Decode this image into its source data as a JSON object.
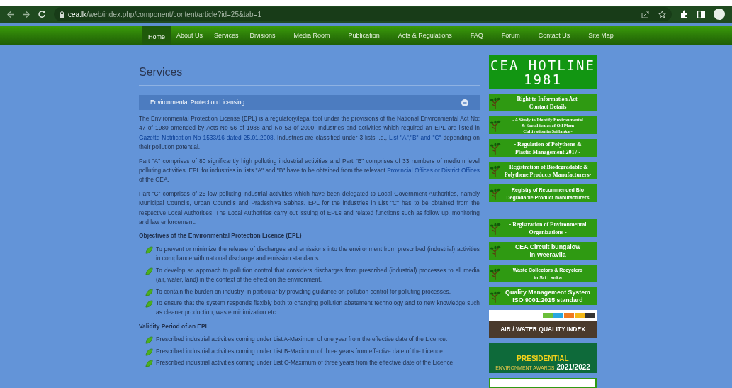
{
  "browser": {
    "url_host": "cea.lk",
    "url_path": "/web/index.php/component/content/article?id=25&tab=1"
  },
  "nav": [
    {
      "label": "Home",
      "selected": true
    },
    {
      "label": "About Us",
      "selected": false
    },
    {
      "label": "Services",
      "selected": false
    },
    {
      "label": "Divisions",
      "selected": false
    },
    {
      "label": "Media Room",
      "selected": false
    },
    {
      "label": "Publication",
      "selected": false
    },
    {
      "label": "Acts & Regulations",
      "selected": false
    },
    {
      "label": "FAQ",
      "selected": false
    },
    {
      "label": "Forum",
      "selected": false
    },
    {
      "label": "Contact Us",
      "selected": false
    },
    {
      "label": "Site Map",
      "selected": false
    }
  ],
  "page_title": "Services",
  "accordion": {
    "title": "Environmental Protection Licensing",
    "expanded": true
  },
  "paragraphs": [
    [
      {
        "kind": "text",
        "text": "The Environmental Protection License (EPL) is a regulatory/legal tool under the provisions of the National Environmental Act No: 47 of 1980 amended by Acts No 56 of 1988 and No 53 of 2000. Industries and activities which required an EPL are listed in "
      },
      {
        "kind": "link",
        "text": "Gazette Notification No 1533/16 dated 25.01.2008"
      },
      {
        "kind": "text",
        "text": ". Industries are classified under 3 lists i.e., "
      },
      {
        "kind": "link",
        "text": "List \"A\",\"B\" and \"C\""
      },
      {
        "kind": "text",
        "text": " depending on their pollution potential."
      }
    ],
    [
      {
        "kind": "text",
        "text": "Part \"A\" comprises of 80 significantly high polluting industrial activities and Part \"B\" comprises of 33 numbers of medium level polluting activities. EPL for industries in lists \"A\" and \"B\" have to be obtained from the relevant "
      },
      {
        "kind": "link",
        "text": "Provincial Offices or District Offices"
      },
      {
        "kind": "text",
        "text": " of the CEA."
      }
    ],
    [
      {
        "kind": "text",
        "text": "Part \"C\" comprises of 25 low polluting industrial activities which have been delegated to Local Government Authorities, namely Municipal Councils, Urban Councils and Pradeshiya Sabhas. EPL for the industries in List \"C\" has to be obtained from the respective Local Authorities. The Local Authorities carry out issuing of EPLs and related functions such as follow up, monitoring and law enforcement."
      }
    ]
  ],
  "sections": [
    {
      "heading": "Objectives of the Environmental Protection Licence (EPL)",
      "items": [
        "To prevent or minimize the release of discharges and emissions into the environment from prescribed (industrial) activities in compliance with national discharge and emission standards.",
        "To develop an approach to pollution control that considers discharges from prescribed (industrial) processes to all media (air, water, land) in the context of the effect on the environment.",
        "To contain the burden on industry, in particular by providing guidance on pollution control for polluting processes.",
        "To ensure that the system responds flexibly both to changing pollution abatement technology and to new knowledge such as cleaner production, waste minimization etc."
      ]
    },
    {
      "heading": "Validity Period of an EPL",
      "items": [
        "Prescribed industrial activities coming under List A-Maximum of one year from the effective date of the Licence.",
        "Prescribed industrial activities coming under List B-Maximum of three years from effective date of the Licence.",
        "Prescribed industrial activities coming under List C-Maximum of three years from the effective date of the Licence"
      ]
    }
  ],
  "sidebar": [
    {
      "kind": "hotline",
      "lines": [
        "CEA HOTLINE",
        "1981"
      ]
    },
    {
      "kind": "leaf-serif",
      "lines": [
        "-Right to Information Act -",
        "Contact Details"
      ]
    },
    {
      "kind": "leaf-serif-small",
      "lines": [
        "- A Study to Identify Environmental",
        "& Social  issues of Oil Plam",
        "Cultivation in Sri lanka -"
      ]
    },
    {
      "kind": "leaf-serif",
      "lines": [
        "- Regulation of  Polythene &",
        "Plastic Management 2017 -"
      ]
    },
    {
      "kind": "leaf-serif",
      "lines": [
        "-Registration of Biodegradable &",
        "Polythene Products Manufacturers-"
      ]
    },
    {
      "kind": "leaf-sans",
      "lines": [
        "Registry of Recommended Bio",
        "Degradable Product manufacturers"
      ]
    },
    {
      "kind": "spacer"
    },
    {
      "kind": "leaf-serif",
      "lines": [
        "- Registration of Environmental",
        "Organizations -"
      ]
    },
    {
      "kind": "leaf-sans-large",
      "lines": [
        "CEA Circuit bungalow",
        "in Weeravila"
      ]
    },
    {
      "kind": "leaf-sans",
      "lines": [
        "Waste Collectors & Recyclers",
        "in Sri Lanka"
      ]
    },
    {
      "kind": "leaf-sans-large",
      "lines": [
        "Quality Management System",
        "ISO 9001:2015 standard"
      ]
    },
    {
      "kind": "air-index",
      "lines": [
        "AIR / WATER QUALITY INDEX"
      ]
    },
    {
      "kind": "awards",
      "lines": [
        "PRESIDENTIAL",
        "ENVIRONMENT AWARDS",
        "2021/2022"
      ]
    },
    {
      "kind": "cut-banner"
    }
  ]
}
